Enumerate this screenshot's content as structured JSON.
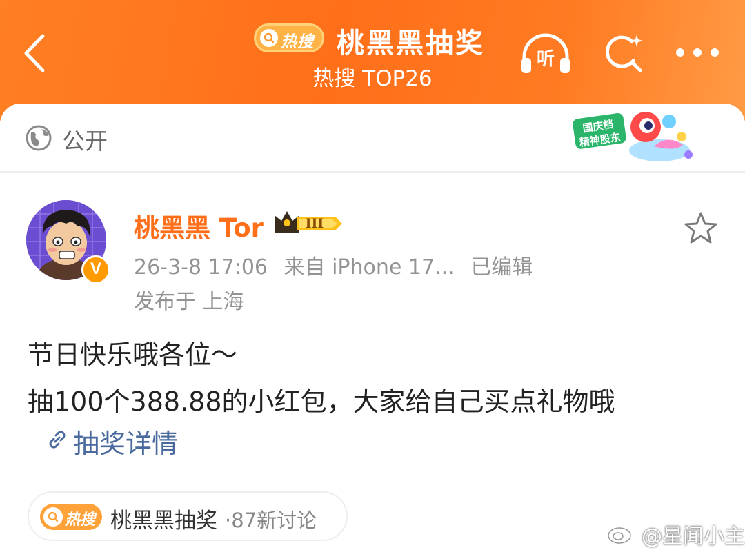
{
  "header": {
    "hot_badge": "热搜",
    "title": "桃黑黑抽奖",
    "subtitle": "热搜 TOP26"
  },
  "privacy": {
    "label": "公开",
    "sticker_text": "国庆档 精神股东"
  },
  "post": {
    "author": "桃黑黑 Tor",
    "member_level": "III",
    "verified_mark": "V",
    "timestamp": "26-3-8 17:06",
    "source": "来自 iPhone 17...",
    "edited": "已编辑",
    "location": "发布于 上海",
    "lines": [
      "节日快乐哦各位～",
      "抽100个388.88的小红包，大家给自己买点礼物哦"
    ],
    "link_label": "抽奖详情"
  },
  "topic_chip": {
    "badge": "热搜",
    "name": "桃黑黑抽奖",
    "count": "·87新讨论"
  },
  "watermark": {
    "text": "@星闻小主"
  },
  "colors": {
    "brand_orange": "#ff7020",
    "username": "#ff6f1a",
    "link": "#4a6a9e",
    "meta": "#939393"
  },
  "icons": {
    "back": "chevron-left-icon",
    "listen": "headphones-icon",
    "search": "search-icon",
    "more": "more-dots-icon",
    "globe": "globe-icon",
    "favorite": "star-outline-icon",
    "link": "link-icon"
  }
}
